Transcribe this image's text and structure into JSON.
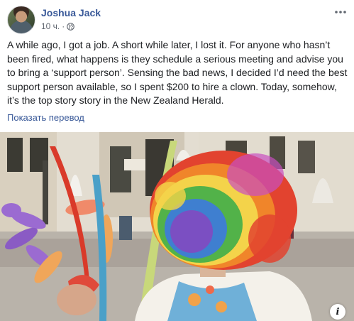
{
  "post": {
    "author": "Joshua Jack",
    "time": "10 ч.",
    "separator": "·",
    "privacy_icon": "globe-icon",
    "menu_icon": "more-horizontal-icon",
    "text": "A while ago, I got a job. A short while later, I lost it. For anyone who hasn’t been fired, what happens is they schedule a serious meeting and advise you to bring a ‘support person’. Sensing the bad news, I decided I’d need the best support person available, so I spent $200 to hire a clown. Today, somehow, it’s the top story story in the New Zealand Herald.",
    "translate_link": "Показать перевод",
    "photo_info_label": "i"
  },
  "colors": {
    "link": "#385898",
    "text": "#1c1e21",
    "meta": "#616770"
  }
}
